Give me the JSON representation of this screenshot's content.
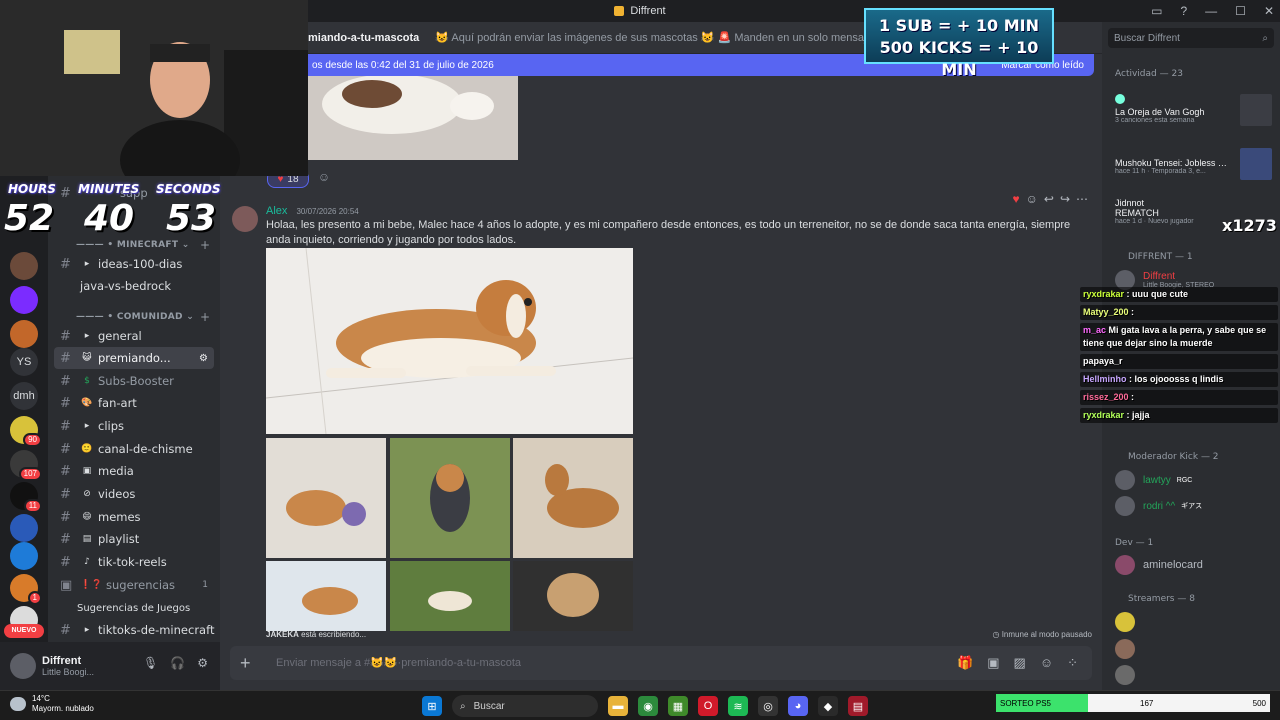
{
  "window": {
    "title": "Diffrent"
  },
  "search": {
    "placeholder": "Buscar Diffrent"
  },
  "channel_header": {
    "name": "miando-a-tu-mascota",
    "topic": "😺 Aquí podrán enviar las imágenes de sus mascotas 😺 🚨 Manden en un solo mensaje todas las fotos de s"
  },
  "new_messages_bar": {
    "text": "os desde las 0:42 del 31 de julio de 2026",
    "action": "Marcar como leído"
  },
  "sidebar": {
    "server_partial": "sapp",
    "categories": [
      {
        "label": "——— • MINECRAFT ⌄"
      },
      {
        "label": "——— • COMUNIDAD ⌄"
      }
    ],
    "channels": [
      {
        "label": "ideas-100-dias",
        "emoji": "▸"
      },
      {
        "label": "java-vs-bedrock",
        "emoji": ""
      },
      {
        "label": "general",
        "emoji": "▸"
      },
      {
        "label": "premiando...",
        "emoji": "😺"
      },
      {
        "label": "Subs-Booster",
        "emoji": "$"
      },
      {
        "label": "fan-art",
        "emoji": "🎨"
      },
      {
        "label": "clips",
        "emoji": "▸"
      },
      {
        "label": "canal-de-chisme",
        "emoji": "🙂"
      },
      {
        "label": "media",
        "emoji": "▣"
      },
      {
        "label": "videos",
        "emoji": "⊘"
      },
      {
        "label": "memes",
        "emoji": "😄"
      },
      {
        "label": "playlist",
        "emoji": "▤"
      },
      {
        "label": "tik-tok-reels",
        "emoji": "♪"
      },
      {
        "label": "sugerencias",
        "emoji": "❗❓",
        "count": "1"
      },
      {
        "label": "Sugerencias de Juegos",
        "emoji": ""
      },
      {
        "label": "tiktoks-de-minecraft",
        "emoji": "▸"
      }
    ]
  },
  "rail": {
    "servers": [
      "YS",
      "dmh"
    ],
    "badges": [
      "90",
      "107",
      "11",
      "1"
    ],
    "new_label": "NUEVO"
  },
  "user_panel": {
    "name": "Diffrent",
    "status": "Little Boogi..."
  },
  "messages": {
    "prev_reaction_count": "18",
    "author": "Alex",
    "timestamp": "30/07/2026 20:54",
    "text": "Holaa, les presento a mi bebe, Malec hace 4 años lo adopte, y es mi compañero desde entonces, es todo un terreneitor, no se de donde saca tanta energía, siempre anda inquieto, corriendo y jugando por todos lados."
  },
  "typing": {
    "user": "JAKEKA",
    "suffix": " está escribiendo..."
  },
  "slowmode": {
    "text": "Inmune al modo pausado"
  },
  "composer": {
    "placeholder": "Enviar mensaje a #😺😺·premiando-a-tu-mascota"
  },
  "members": {
    "activity_header": "Actividad — 23",
    "activity": [
      {
        "title": "La Oreja de Van Gogh",
        "sub": "3 canciones esta semana"
      },
      {
        "title": "Mushoku Tensei: Jobless R...",
        "sub": "hace 11 h · Temporada 3, e..."
      },
      {
        "title": "REMATCH",
        "sub": "hace 1 d · Nuevo jugador",
        "user": "Jidnnot"
      }
    ],
    "sections": [
      {
        "label": "DIFFRENT — 1"
      },
      {
        "label": "Moderador Kick — 2"
      },
      {
        "label": "Dev — 1"
      },
      {
        "label": "Streamers — 8"
      }
    ],
    "people": [
      {
        "name": "Diffrent",
        "sub": "Little Boogie, STEREO",
        "color": "#f23f43"
      },
      {
        "name": "lawtyy",
        "tag": "RGC",
        "color": "#23a55a"
      },
      {
        "name": "rodri ^^",
        "tag": "ギアス",
        "color": "#23a55a"
      },
      {
        "name": "aminelocard",
        "color": "#949ba4"
      }
    ]
  },
  "overlay": {
    "timer": {
      "labels": [
        "HOURS",
        "MINUTES",
        "SECONDS"
      ],
      "values": [
        "52",
        "40",
        "53"
      ]
    },
    "sub_banner": [
      "1 SUB = + 10 MIN",
      "500 KICKS = + 10 MIN"
    ],
    "kill_score": "x1273",
    "chat": [
      {
        "user": "ryxdrakar",
        "text": " : uuu que cute"
      },
      {
        "user": "Matyy_200",
        "text": " : "
      },
      {
        "user": "m_ac",
        "text": "Mi gata lava a la perra, y sabe que se tiene que dejar sino la muerde"
      },
      {
        "user": "papaya_r",
        "text": ""
      },
      {
        "user": "Hellminho",
        "text": " : los ojooosss q lindis"
      },
      {
        "user": "rissez_200",
        "text": " : "
      },
      {
        "user": "ryxdrakar",
        "text": " : jajja"
      }
    ]
  },
  "taskbar": {
    "weather_temp": "14°C",
    "weather_desc": "Mayorm. nublado",
    "search_label": "Buscar",
    "goal_label": "SORTEO PS5",
    "goal_current": "167",
    "goal_target": "500",
    "goal_fraction": 0.334
  },
  "colors": {
    "accent": "#5865f2",
    "author": "#1abc9c",
    "online": "#23a55a"
  }
}
